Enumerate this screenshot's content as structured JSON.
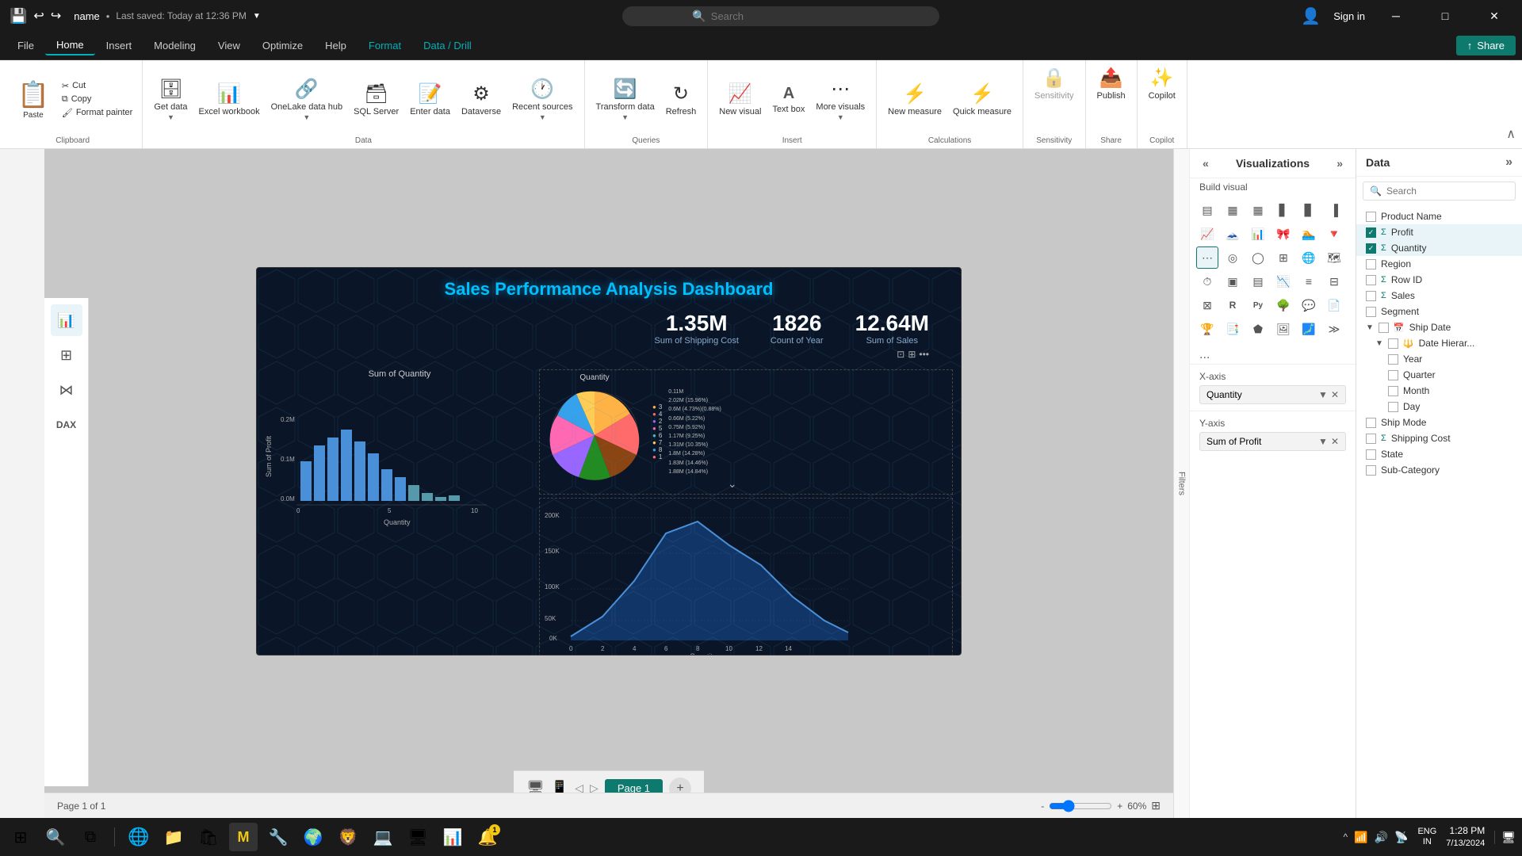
{
  "titlebar": {
    "filename": "name",
    "saved": "Last saved: Today at 12:36 PM",
    "search_placeholder": "Search",
    "sign_in": "Sign in",
    "minimize": "─",
    "maximize": "□",
    "close": "✕"
  },
  "menubar": {
    "items": [
      "File",
      "Home",
      "Insert",
      "Modeling",
      "View",
      "Optimize",
      "Help",
      "Format",
      "Data / Drill"
    ],
    "active": "Home",
    "teal_items": [
      "Format",
      "Data / Drill"
    ],
    "share_label": "Share"
  },
  "ribbon": {
    "clipboard": {
      "group": "Clipboard",
      "paste": "Paste",
      "cut": "Cut",
      "copy": "Copy",
      "format_painter": "Format painter"
    },
    "data": {
      "group": "Data",
      "get_data": "Get data",
      "excel": "Excel workbook",
      "onelake": "OneLake data hub",
      "sql": "SQL Server",
      "enter": "Enter data",
      "dataverse": "Dataverse",
      "recent": "Recent sources"
    },
    "queries": {
      "group": "Queries",
      "transform": "Transform data",
      "refresh": "Refresh"
    },
    "insert": {
      "group": "Insert",
      "new_visual": "New visual",
      "text_box": "Text box",
      "more_visuals": "More visuals"
    },
    "calculations": {
      "group": "Calculations",
      "new_measure": "New measure",
      "quick_measure": "Quick measure"
    },
    "sensitivity": {
      "group": "Sensitivity",
      "label": "Sensitivity"
    },
    "share": {
      "group": "Share",
      "publish": "Publish"
    },
    "copilot": {
      "group": "Copilot",
      "label": "Copilot"
    }
  },
  "visualizations": {
    "title": "Visualizations",
    "sub": "Build visual",
    "expand_left": "«",
    "expand_right": "»",
    "icons": [
      "▤",
      "▦",
      "▦",
      "▋",
      "▊",
      "▐",
      "◈",
      "⬡",
      "🔀",
      "⋯",
      "◎",
      "◯",
      "⟨⟩",
      "🔷",
      "⊞",
      "⬢",
      "⊕",
      "◉",
      "◐",
      "◑",
      "Py",
      "📊",
      "🔣",
      "💬",
      "🏆",
      "📈",
      "⊙",
      "🌐",
      "🔷",
      "≫"
    ],
    "x_axis_label": "X-axis",
    "x_axis_field": "Quantity",
    "y_axis_label": "Y-axis",
    "y_axis_field": "Sum of Profit",
    "more_dots": "..."
  },
  "data_panel": {
    "title": "Data",
    "expand": "»",
    "search_placeholder": "Search",
    "fields": [
      {
        "name": "Product Name",
        "checked": false,
        "type": "text"
      },
      {
        "name": "Profit",
        "checked": true,
        "type": "sigma"
      },
      {
        "name": "Quantity",
        "checked": true,
        "type": "sigma"
      },
      {
        "name": "Region",
        "checked": false,
        "type": "text"
      },
      {
        "name": "Row ID",
        "checked": false,
        "type": "sigma"
      },
      {
        "name": "Sales",
        "checked": false,
        "type": "sigma"
      },
      {
        "name": "Segment",
        "checked": false,
        "type": "text"
      },
      {
        "name": "Ship Date",
        "checked": false,
        "type": "calendar",
        "expanded": true
      },
      {
        "name": "Date Hierar...",
        "checked": false,
        "type": "hierarchy",
        "indent": 1
      },
      {
        "name": "Year",
        "checked": false,
        "type": "text",
        "indent": 2
      },
      {
        "name": "Quarter",
        "checked": false,
        "type": "text",
        "indent": 2
      },
      {
        "name": "Month",
        "checked": false,
        "type": "text",
        "indent": 2
      },
      {
        "name": "Day",
        "checked": false,
        "type": "text",
        "indent": 2
      },
      {
        "name": "Ship Mode",
        "checked": false,
        "type": "text"
      },
      {
        "name": "Shipping Cost",
        "checked": false,
        "type": "sigma"
      },
      {
        "name": "State",
        "checked": false,
        "type": "text"
      },
      {
        "name": "Sub-Category",
        "checked": false,
        "type": "text"
      }
    ]
  },
  "canvas": {
    "dashboard_title": "Sales Performance Analysis Dashboard",
    "kpis": [
      {
        "value": "1.35M",
        "label": "Sum of Shipping Cost"
      },
      {
        "value": "1826",
        "label": "Count of Year"
      },
      {
        "value": "12.64M",
        "label": "Sum of Sales"
      }
    ],
    "bar_chart_title": "Sum of Quantity",
    "bar_chart_y_label": "Sum of Profit",
    "pie_chart_title": "Quantity",
    "pie_slices": [
      {
        "pct": "0.11M",
        "label": "2.02M (15.96%)",
        "color": "#FF6B6B"
      },
      {
        "pct": "0.6M (4.73%)",
        "label": "",
        "color": "#FF9F40"
      },
      {
        "pct": "0.88%",
        "label": "",
        "color": "#FFCD56"
      },
      {
        "pct": "0.66M (5.22%)",
        "label": "",
        "color": "#4BC0C0"
      },
      {
        "pct": "0.75M (5.92%)",
        "label": "",
        "color": "#9966FF"
      },
      {
        "pct": "1.17M (9.25%)",
        "label": "",
        "color": "#FF6384"
      },
      {
        "pct": "1.31M (10.35%)",
        "label": "",
        "color": "#36A2EB"
      },
      {
        "pct": "1.8M (14.28%)",
        "label": "",
        "color": "#C9CBCF"
      },
      {
        "pct": "1.83M (14.46%)",
        "label": "",
        "color": "#8B4513"
      },
      {
        "pct": "1.88M (14.84%)",
        "label": "",
        "color": "#228B22"
      }
    ],
    "area_chart_x": "Quantity",
    "area_chart_y_values": [
      "50K",
      "100K",
      "150K",
      "200K"
    ],
    "area_chart_x_values": [
      "0",
      "2",
      "4",
      "6",
      "8",
      "10",
      "12",
      "14"
    ]
  },
  "pages": {
    "current": "Page 1",
    "total": "Page 1 of 1",
    "add_label": "+"
  },
  "statusbar": {
    "page_info": "Page 1 of 1",
    "zoom": "60%"
  },
  "taskbar": {
    "time": "1:28 PM",
    "date": "7/13/2024",
    "lang": "ENG\nIN"
  }
}
